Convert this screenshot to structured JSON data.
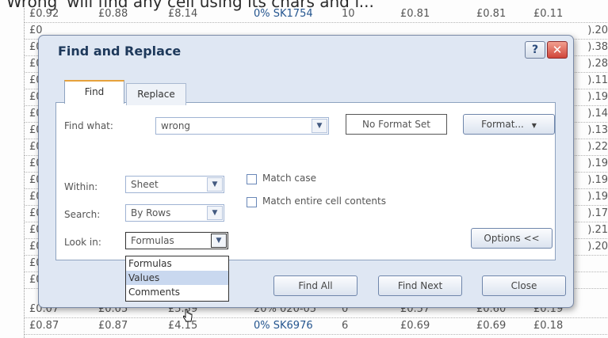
{
  "caption": "Wrong' will find any cell using its chars and f...",
  "sheet": {
    "top_row": [
      "£0.92",
      "£0.88",
      "£8.14",
      "0% SK1754",
      "10",
      "£0.81",
      "£0.81",
      "£0.11"
    ],
    "left_edge": [
      "£0",
      "£0",
      "£0",
      "£0",
      "£0",
      "£0",
      "£0",
      "£0",
      "£0",
      "£0",
      "£0",
      "£0",
      "£0",
      "£0",
      "£0",
      "£0"
    ],
    "right_edge": [
      ").20",
      ").38",
      ").28",
      ").11",
      ").19",
      ").14",
      ").13",
      ").22",
      ").19",
      ").19",
      ").19",
      ").17",
      ").21",
      ").20"
    ],
    "partial_row": [
      "£0.07",
      "£0.05",
      "£5.59",
      "20% 020-05",
      "0",
      "£0.57",
      "£0.60",
      "£0.19"
    ],
    "bottom_row": [
      "£0.87",
      "£0.87",
      "£4.15",
      "0% SK6976",
      "6",
      "£0.69",
      "£0.69",
      "£0.18"
    ]
  },
  "dialog": {
    "title": "Find and Replace",
    "help_glyph": "?",
    "close_glyph": "✕",
    "tabs": {
      "find": "Find",
      "replace": "Replace"
    },
    "find_what_label": "Find what:",
    "find_what_value": "wrong",
    "format_status": "No Format Set",
    "format_button": "Format...",
    "within_label": "Within:",
    "within_value": "Sheet",
    "search_label": "Search:",
    "search_value": "By Rows",
    "lookin_label": "Look in:",
    "lookin_value": "Formulas",
    "match_case": "Match case",
    "match_entire": "Match entire cell contents",
    "options_button": "Options <<",
    "find_all": "Find All",
    "find_next": "Find Next",
    "close": "Close",
    "lookin_options": [
      "Formulas",
      "Values",
      "Comments"
    ],
    "lookin_highlighted": "Values"
  },
  "colors": {
    "dialog_bg": "#dfe7f3",
    "title": "#1e395b",
    "accent_tab": "#e6a23c",
    "close_red": "#d0453a"
  }
}
